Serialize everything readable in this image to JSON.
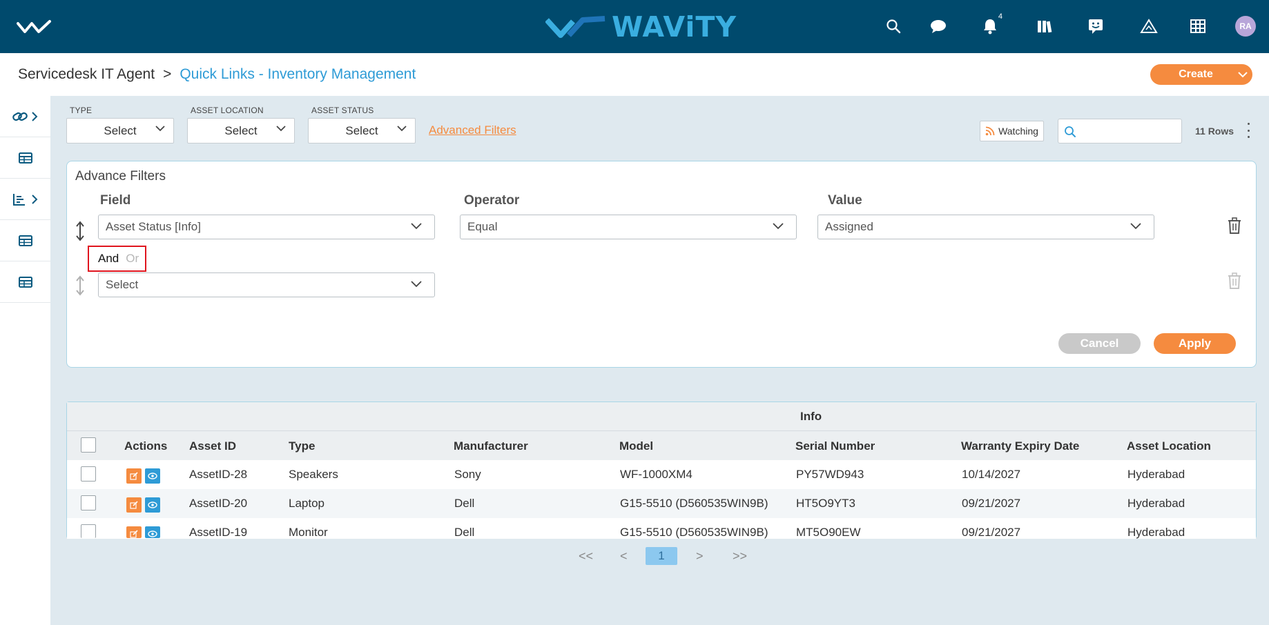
{
  "app": {
    "brand": "WAViTY",
    "notification_count": "4",
    "avatar_initials": "RA"
  },
  "breadcrumb": {
    "root": "Servicedesk IT Agent",
    "separator": ">",
    "current": "Quick Links - Inventory Management"
  },
  "create_label": "Create",
  "filters": {
    "type_label": "TYPE",
    "type_value": "Select",
    "location_label": "ASSET LOCATION",
    "location_value": "Select",
    "status_label": "ASSET STATUS",
    "status_value": "Select",
    "advanced_link": "Advanced Filters",
    "watching_label": "Watching",
    "search_placeholder": "",
    "rows_count": "11 Rows"
  },
  "advance_filters": {
    "title": "Advance Filters",
    "field_header": "Field",
    "operator_header": "Operator",
    "value_header": "Value",
    "rule1": {
      "field": "Asset Status [Info]",
      "operator": "Equal",
      "value": "Assigned"
    },
    "and_label": "And",
    "or_label": "Or",
    "rule2": {
      "field": "Select"
    },
    "cancel_label": "Cancel",
    "apply_label": "Apply"
  },
  "table": {
    "group_label": "Info",
    "headers": [
      "Actions",
      "Asset ID",
      "Type",
      "Manufacturer",
      "Model",
      "Serial Number",
      "Warranty Expiry Date",
      "Asset Location"
    ],
    "rows": [
      {
        "asset_id": "AssetID-28",
        "type": "Speakers",
        "manufacturer": "Sony",
        "model": "WF-1000XM4",
        "serial": "PY57WD943",
        "warranty": "10/14/2027",
        "location": "Hyderabad"
      },
      {
        "asset_id": "AssetID-20",
        "type": "Laptop",
        "manufacturer": "Dell",
        "model": "G15-5510 (D560535WIN9B)",
        "serial": "HT5O9YT3",
        "warranty": "09/21/2027",
        "location": "Hyderabad"
      },
      {
        "asset_id": "AssetID-19",
        "type": "Monitor",
        "manufacturer": "Dell",
        "model": "G15-5510 (D560535WIN9B)",
        "serial": "MT5O90EW",
        "warranty": "09/21/2027",
        "location": "Hyderabad"
      }
    ]
  },
  "pagination": {
    "first": "<<",
    "prev": "<",
    "current": "1",
    "next": ">",
    "last": ">>"
  },
  "colors": {
    "topbar": "#004a6d",
    "accent_orange": "#f58b3f",
    "accent_blue": "#2e9bd6",
    "highlight_red": "#e0141e"
  },
  "icons": [
    "logo-checkmark-icon",
    "search-icon",
    "chat-icon",
    "bell-icon",
    "library-icon",
    "feedback-icon",
    "warning-icon",
    "grid-icon",
    "link-icon",
    "table-icon",
    "chart-icon",
    "rss-icon",
    "sort-handle-icon",
    "trash-icon",
    "edit-icon",
    "eye-icon",
    "chevron-down-icon"
  ]
}
